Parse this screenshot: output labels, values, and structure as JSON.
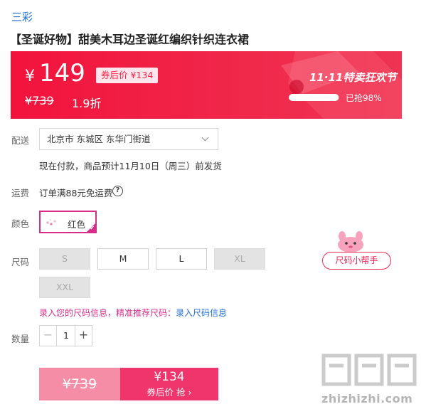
{
  "brand": "三彩",
  "product_title": "【圣诞好物】甜美木耳边圣诞红编织针织连衣裙",
  "price_banner": {
    "currency": "¥",
    "price": "149",
    "coupon_label": "券后价 ¥134",
    "original_price": "¥739",
    "discount": "1.9折",
    "event_label": "11·11特卖狂欢节",
    "sold_label": "已抢98%",
    "sold_fraction": 0.98,
    "accent_color": "#f2133c"
  },
  "delivery": {
    "label": "配送",
    "address": "北京市 东城区 东华门街道",
    "ship_note": "现在付款，商品预计11月10日（周三）前发货"
  },
  "freight": {
    "label": "运费",
    "text": "订单满88元免运费",
    "help_icon": "?"
  },
  "color": {
    "label": "颜色",
    "selected": "红色",
    "check": "✔"
  },
  "size": {
    "label": "尺码",
    "options": [
      {
        "label": "S",
        "available": false
      },
      {
        "label": "M",
        "available": true
      },
      {
        "label": "L",
        "available": true
      },
      {
        "label": "XL",
        "available": false
      },
      {
        "label": "XXL",
        "available": false
      }
    ],
    "helper_label": "尺码小帮手",
    "info_text": "录入您的尺码信息，精准推荐尺码：",
    "info_link": "录入尺码信息"
  },
  "quantity": {
    "label": "数量",
    "minus": "−",
    "value": "1",
    "plus": "+"
  },
  "buy_bar": {
    "original_price": "¥739",
    "coupon_price": "¥134",
    "action_label": "券后价 抢 ›"
  },
  "watermark": "zhizhizhi.com"
}
